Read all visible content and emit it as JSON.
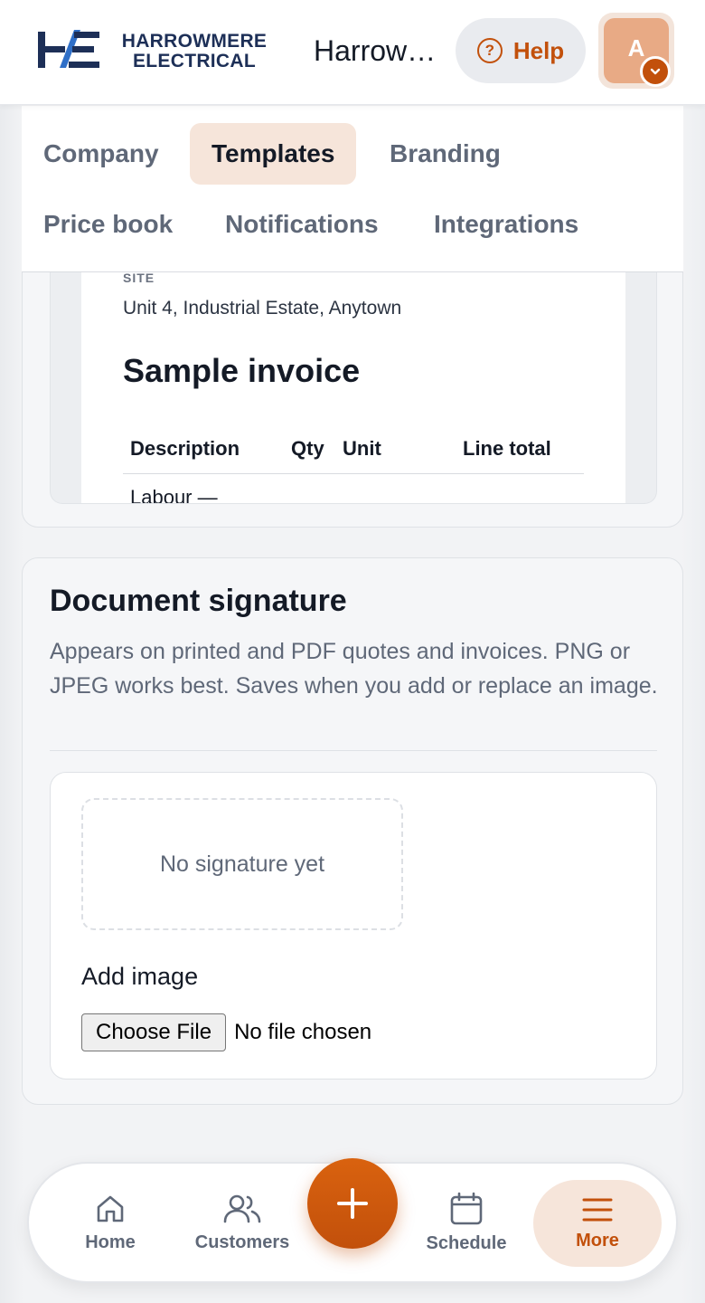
{
  "header": {
    "logo_line1": "HARROWMERE",
    "logo_line2": "ELECTRICAL",
    "org_name": "Harrowmere Electrical",
    "help_label": "Help",
    "avatar_initial": "A"
  },
  "tabs": [
    {
      "label": "Company",
      "active": false
    },
    {
      "label": "Templates",
      "active": true
    },
    {
      "label": "Branding",
      "active": false
    },
    {
      "label": "Price book",
      "active": false
    },
    {
      "label": "Notifications",
      "active": false
    },
    {
      "label": "Integrations",
      "active": false
    }
  ],
  "preview": {
    "site_label": "SITE",
    "site_address": "Unit 4, Industrial Estate, Anytown",
    "title": "Sample invoice",
    "columns": [
      "Description",
      "Qty",
      "Unit",
      "Line total"
    ],
    "first_row_desc": "Labour —"
  },
  "signature": {
    "title": "Document signature",
    "description": "Appears on printed and PDF quotes and invoices. PNG or JPEG works best. Saves when you add or replace an image.",
    "empty_text": "No signature yet",
    "add_label": "Add image",
    "file_button": "Choose File",
    "file_status": "No file chosen"
  },
  "nav": {
    "home": "Home",
    "customers": "Customers",
    "schedule": "Schedule",
    "more": "More",
    "active": "more"
  },
  "colors": {
    "accent": "#c2500b",
    "accent_soft": "#f6e5da",
    "text": "#141a26",
    "muted": "#5f6878",
    "brand_navy": "#1d2f57"
  }
}
